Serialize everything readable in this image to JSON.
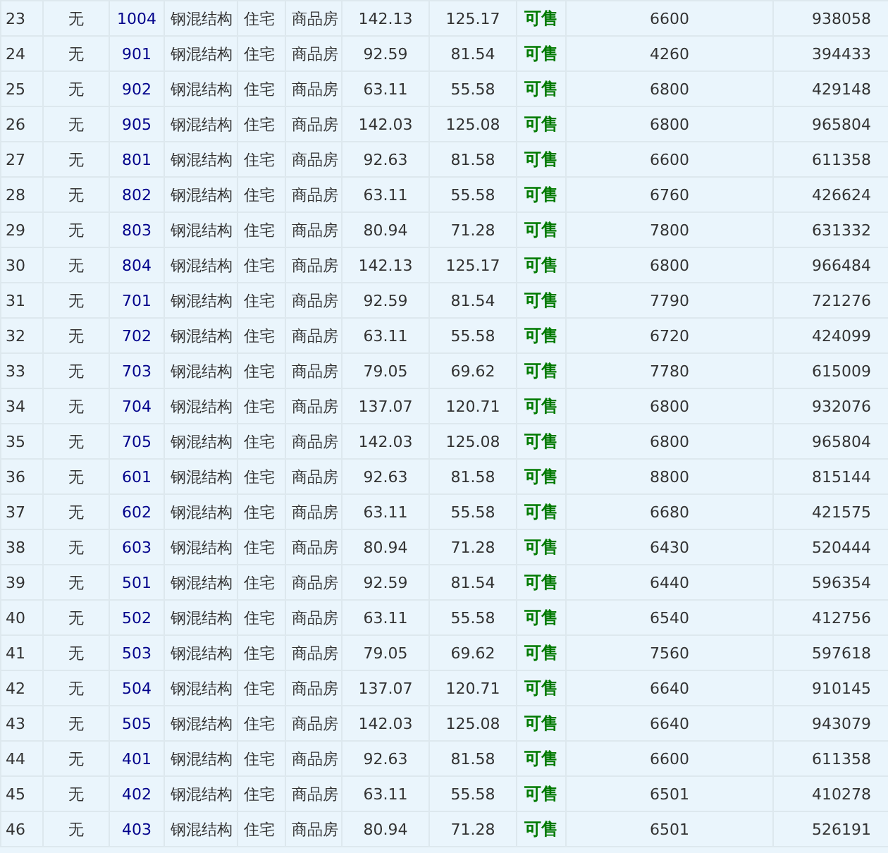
{
  "table": {
    "rows": [
      {
        "cells": [
          "23",
          "无",
          "1004",
          "钢混结构",
          "住宅",
          "商品房",
          "142.13",
          "125.17",
          "可售",
          "6600",
          "938058"
        ]
      },
      {
        "cells": [
          "24",
          "无",
          "901",
          "钢混结构",
          "住宅",
          "商品房",
          "92.59",
          "81.54",
          "可售",
          "4260",
          "394433"
        ]
      },
      {
        "cells": [
          "25",
          "无",
          "902",
          "钢混结构",
          "住宅",
          "商品房",
          "63.11",
          "55.58",
          "可售",
          "6800",
          "429148"
        ]
      },
      {
        "cells": [
          "26",
          "无",
          "905",
          "钢混结构",
          "住宅",
          "商品房",
          "142.03",
          "125.08",
          "可售",
          "6800",
          "965804"
        ]
      },
      {
        "cells": [
          "27",
          "无",
          "801",
          "钢混结构",
          "住宅",
          "商品房",
          "92.63",
          "81.58",
          "可售",
          "6600",
          "611358"
        ]
      },
      {
        "cells": [
          "28",
          "无",
          "802",
          "钢混结构",
          "住宅",
          "商品房",
          "63.11",
          "55.58",
          "可售",
          "6760",
          "426624"
        ]
      },
      {
        "cells": [
          "29",
          "无",
          "803",
          "钢混结构",
          "住宅",
          "商品房",
          "80.94",
          "71.28",
          "可售",
          "7800",
          "631332"
        ]
      },
      {
        "cells": [
          "30",
          "无",
          "804",
          "钢混结构",
          "住宅",
          "商品房",
          "142.13",
          "125.17",
          "可售",
          "6800",
          "966484"
        ]
      },
      {
        "cells": [
          "31",
          "无",
          "701",
          "钢混结构",
          "住宅",
          "商品房",
          "92.59",
          "81.54",
          "可售",
          "7790",
          "721276"
        ]
      },
      {
        "cells": [
          "32",
          "无",
          "702",
          "钢混结构",
          "住宅",
          "商品房",
          "63.11",
          "55.58",
          "可售",
          "6720",
          "424099"
        ]
      },
      {
        "cells": [
          "33",
          "无",
          "703",
          "钢混结构",
          "住宅",
          "商品房",
          "79.05",
          "69.62",
          "可售",
          "7780",
          "615009"
        ]
      },
      {
        "cells": [
          "34",
          "无",
          "704",
          "钢混结构",
          "住宅",
          "商品房",
          "137.07",
          "120.71",
          "可售",
          "6800",
          "932076"
        ]
      },
      {
        "cells": [
          "35",
          "无",
          "705",
          "钢混结构",
          "住宅",
          "商品房",
          "142.03",
          "125.08",
          "可售",
          "6800",
          "965804"
        ]
      },
      {
        "cells": [
          "36",
          "无",
          "601",
          "钢混结构",
          "住宅",
          "商品房",
          "92.63",
          "81.58",
          "可售",
          "8800",
          "815144"
        ]
      },
      {
        "cells": [
          "37",
          "无",
          "602",
          "钢混结构",
          "住宅",
          "商品房",
          "63.11",
          "55.58",
          "可售",
          "6680",
          "421575"
        ]
      },
      {
        "cells": [
          "38",
          "无",
          "603",
          "钢混结构",
          "住宅",
          "商品房",
          "80.94",
          "71.28",
          "可售",
          "6430",
          "520444"
        ]
      },
      {
        "cells": [
          "39",
          "无",
          "501",
          "钢混结构",
          "住宅",
          "商品房",
          "92.59",
          "81.54",
          "可售",
          "6440",
          "596354"
        ]
      },
      {
        "cells": [
          "40",
          "无",
          "502",
          "钢混结构",
          "住宅",
          "商品房",
          "63.11",
          "55.58",
          "可售",
          "6540",
          "412756"
        ]
      },
      {
        "cells": [
          "41",
          "无",
          "503",
          "钢混结构",
          "住宅",
          "商品房",
          "79.05",
          "69.62",
          "可售",
          "7560",
          "597618"
        ]
      },
      {
        "cells": [
          "42",
          "无",
          "504",
          "钢混结构",
          "住宅",
          "商品房",
          "137.07",
          "120.71",
          "可售",
          "6640",
          "910145"
        ]
      },
      {
        "cells": [
          "43",
          "无",
          "505",
          "钢混结构",
          "住宅",
          "商品房",
          "142.03",
          "125.08",
          "可售",
          "6640",
          "943079"
        ]
      },
      {
        "cells": [
          "44",
          "无",
          "401",
          "钢混结构",
          "住宅",
          "商品房",
          "92.63",
          "81.58",
          "可售",
          "6600",
          "611358"
        ]
      },
      {
        "cells": [
          "45",
          "无",
          "402",
          "钢混结构",
          "住宅",
          "商品房",
          "63.11",
          "55.58",
          "可售",
          "6501",
          "410278"
        ]
      },
      {
        "cells": [
          "46",
          "无",
          "403",
          "钢混结构",
          "住宅",
          "商品房",
          "80.94",
          "71.28",
          "可售",
          "6501",
          "526191"
        ]
      }
    ]
  }
}
